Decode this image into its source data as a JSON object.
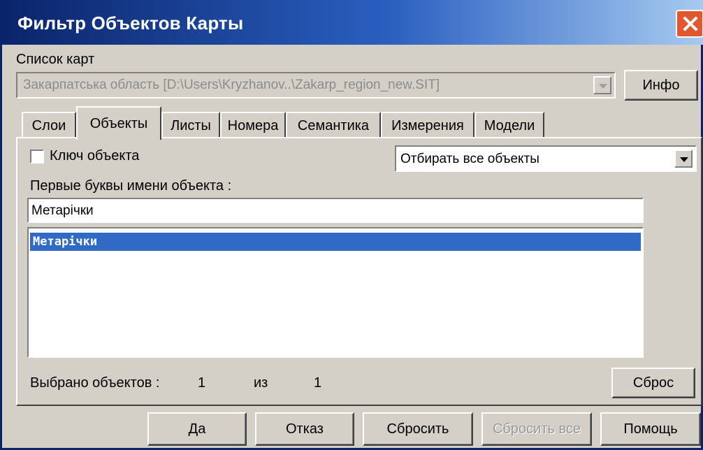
{
  "window": {
    "title": "Фильтр Объектов Карты"
  },
  "maps": {
    "label": "Список карт",
    "selected": "Закарпатська область    [D:\\Users\\Kryzhanov..\\Zakarp_region_new.SIT]",
    "info_button": "Инфо"
  },
  "tabs": [
    {
      "label": "Слои"
    },
    {
      "label": "Объекты",
      "active": true
    },
    {
      "label": "Листы"
    },
    {
      "label": "Номера"
    },
    {
      "label": "Семантика"
    },
    {
      "label": "Измерения"
    },
    {
      "label": "Модели"
    }
  ],
  "objects": {
    "key_checkbox_label": "Ключ объекта",
    "key_checked": false,
    "filter_mode": "Отбирать все объекты",
    "first_letters_label": "Первые буквы имени объекта :",
    "first_letters_value": "Метарічки",
    "list_items": [
      "Метарічки"
    ],
    "selected_label": "Выбрано объектов :",
    "selected_count": "1",
    "of_label": "из",
    "total_count": "1",
    "reset_button": "Сброс"
  },
  "footer": {
    "ok": "Да",
    "cancel": "Отказ",
    "reset": "Сбросить",
    "reset_all": "Сбросить все",
    "help": "Помощь"
  }
}
